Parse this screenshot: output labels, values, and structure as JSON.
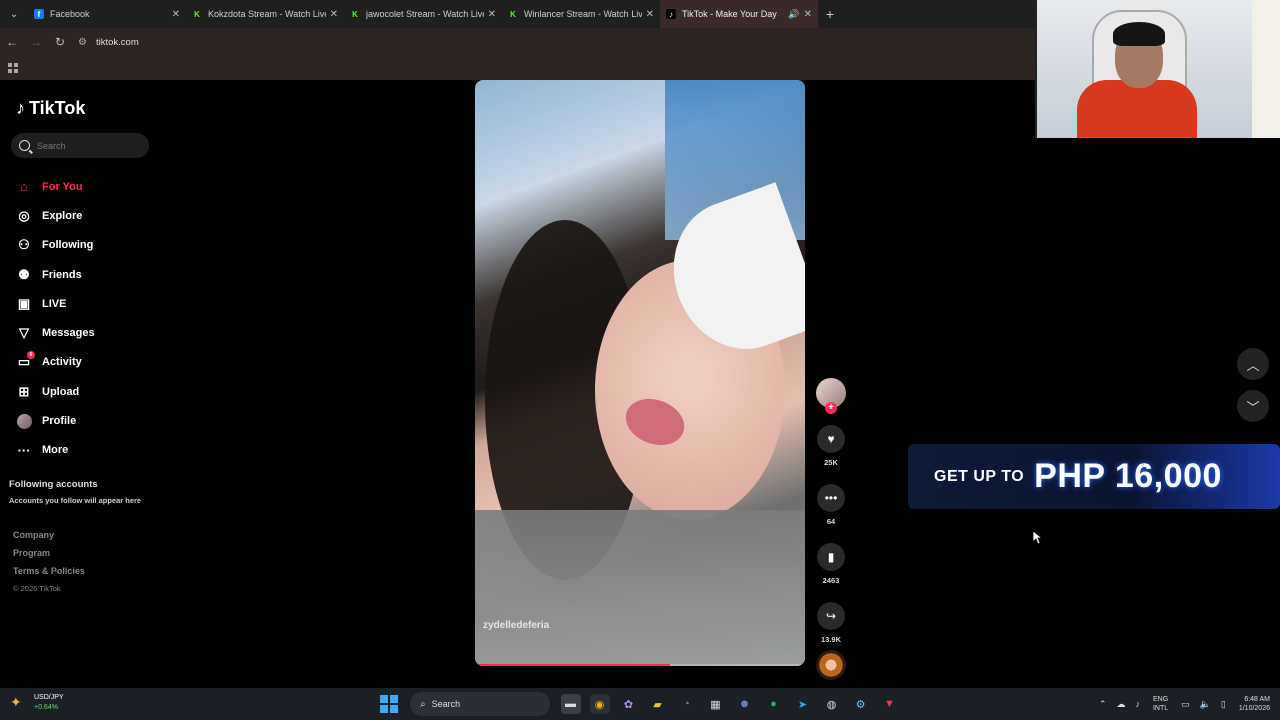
{
  "browser": {
    "tabs": [
      {
        "title": "Facebook",
        "icon": "facebook-icon",
        "color": "#1877f2",
        "glyph": "f",
        "active": false
      },
      {
        "title": "Kokzdota Stream - Watch Live",
        "icon": "kick-icon",
        "color": "#53fc18",
        "glyph": "K",
        "active": false
      },
      {
        "title": "jawocolet Stream - Watch Live",
        "icon": "kick-icon",
        "color": "#53fc18",
        "glyph": "K",
        "active": false
      },
      {
        "title": "Winlancer Stream - Watch Live",
        "icon": "kick-icon",
        "color": "#53fc18",
        "glyph": "K",
        "active": false
      },
      {
        "title": "TikTok - Make Your Day",
        "icon": "tiktok-icon",
        "color": "#ffffff",
        "glyph": "♪",
        "active": true
      }
    ],
    "url": "tiktok.com"
  },
  "sidebar": {
    "logo": "TikTok",
    "search_placeholder": "Search",
    "nav": [
      {
        "label": "For You",
        "icon": "home-icon",
        "glyph": "⌂",
        "active": true
      },
      {
        "label": "Explore",
        "icon": "compass-icon",
        "glyph": "◎",
        "active": false
      },
      {
        "label": "Following",
        "icon": "following-icon",
        "glyph": "⚇",
        "active": false
      },
      {
        "label": "Friends",
        "icon": "friends-icon",
        "glyph": "⚉",
        "active": false
      },
      {
        "label": "LIVE",
        "icon": "live-icon",
        "glyph": "▣",
        "active": false
      },
      {
        "label": "Messages",
        "icon": "messages-icon",
        "glyph": "▽",
        "active": false
      },
      {
        "label": "Activity",
        "icon": "activity-icon",
        "glyph": "▭",
        "active": false,
        "badge": "6"
      },
      {
        "label": "Upload",
        "icon": "upload-icon",
        "glyph": "⊞",
        "active": false
      },
      {
        "label": "Profile",
        "icon": "profile-avatar",
        "glyph": "",
        "active": false
      },
      {
        "label": "More",
        "icon": "more-icon",
        "glyph": "···",
        "active": false
      }
    ],
    "following_title": "Following accounts",
    "following_sub": "Accounts you follow will appear here",
    "footer": [
      "Company",
      "Program",
      "Terms & Policies"
    ],
    "copyright": "© 2026 TikTok"
  },
  "video": {
    "username": "zydelledeferia",
    "progress": 0.59,
    "likes": "25K",
    "comments": "64",
    "saves": "2463",
    "shares": "13.9K"
  },
  "promo": {
    "lead": "GET UP TO",
    "amount": "PHP 16,000"
  },
  "taskbar": {
    "ticker_name": "USD/JPY",
    "ticker_change": "+0.64%",
    "search": "Search",
    "lang_top": "ENG",
    "lang_bottom": "INTL",
    "time": "6:48 AM",
    "date": "1/10/2026"
  }
}
